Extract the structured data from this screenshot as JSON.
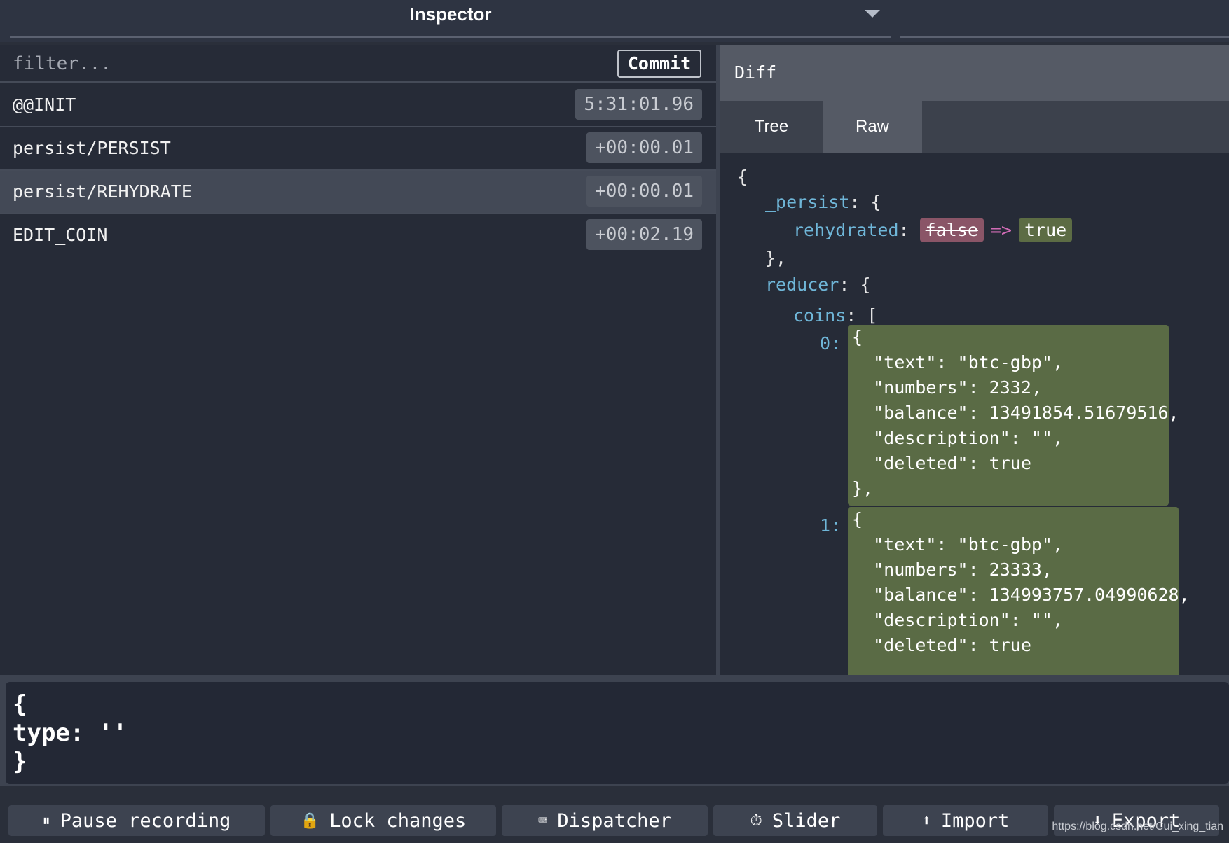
{
  "monitor": {
    "title": "Inspector"
  },
  "filter": {
    "placeholder": "filter...",
    "commit_label": "Commit"
  },
  "actions": [
    {
      "name": "@@INIT",
      "time": "5:31:01.96"
    },
    {
      "name": "persist/PERSIST",
      "time": "+00:00.01"
    },
    {
      "name": "persist/REHYDRATE",
      "time": "+00:00.01",
      "selected": true
    },
    {
      "name": "EDIT_COIN",
      "time": "+00:02.19"
    }
  ],
  "diff": {
    "title": "Diff",
    "tabs": [
      "Tree",
      "Raw"
    ],
    "active_tab": "Raw",
    "lines": {
      "open_brace": "{",
      "persist_key": "_persist",
      "persist_open": ": {",
      "rehydrated_key": "rehydrated",
      "colon": ":",
      "old_value": "false",
      "arrow": "=>",
      "new_value": "true",
      "close_persist": "},",
      "reducer_key": "reducer",
      "reducer_open": ": {",
      "coins_key": "coins",
      "coins_open": ": ["
    },
    "coins": [
      {
        "index": "0:",
        "lines": [
          "{",
          "  \"text\": \"btc-gbp\",",
          "  \"numbers\": 2332,",
          "  \"balance\": 13491854.51679516,",
          "  \"description\": \"\",",
          "  \"deleted\": true",
          "},"
        ]
      },
      {
        "index": "1:",
        "lines": [
          "{",
          "  \"text\": \"btc-gbp\",",
          "  \"numbers\": 23333,",
          "  \"balance\": 134993757.04990628,",
          "  \"description\": \"\",",
          "  \"deleted\": true"
        ]
      }
    ]
  },
  "editor": {
    "text": "{\ntype: ''\n}"
  },
  "toolbar": {
    "buttons": [
      {
        "label": "Pause recording",
        "icon": "pause-circle-icon",
        "glyph": "⏸"
      },
      {
        "label": "Lock changes",
        "icon": "lock-icon",
        "glyph": "🔒"
      },
      {
        "label": "Dispatcher",
        "icon": "keyboard-icon",
        "glyph": "⌨"
      },
      {
        "label": "Slider",
        "icon": "stopwatch-icon",
        "glyph": "⏱"
      },
      {
        "label": "Import",
        "icon": "upload-icon",
        "glyph": "⬆"
      },
      {
        "label": "Export",
        "icon": "download-icon",
        "glyph": "⬇"
      }
    ]
  },
  "watermark": "https://blog.csdn.net/Cui_xing_tian",
  "colors": {
    "background": "#2a2f3a",
    "panel": "#262b37",
    "key": "#6fb6d8",
    "added": "#5a6b45",
    "removed": "#8a5567",
    "arrow": "#d06bb5"
  }
}
